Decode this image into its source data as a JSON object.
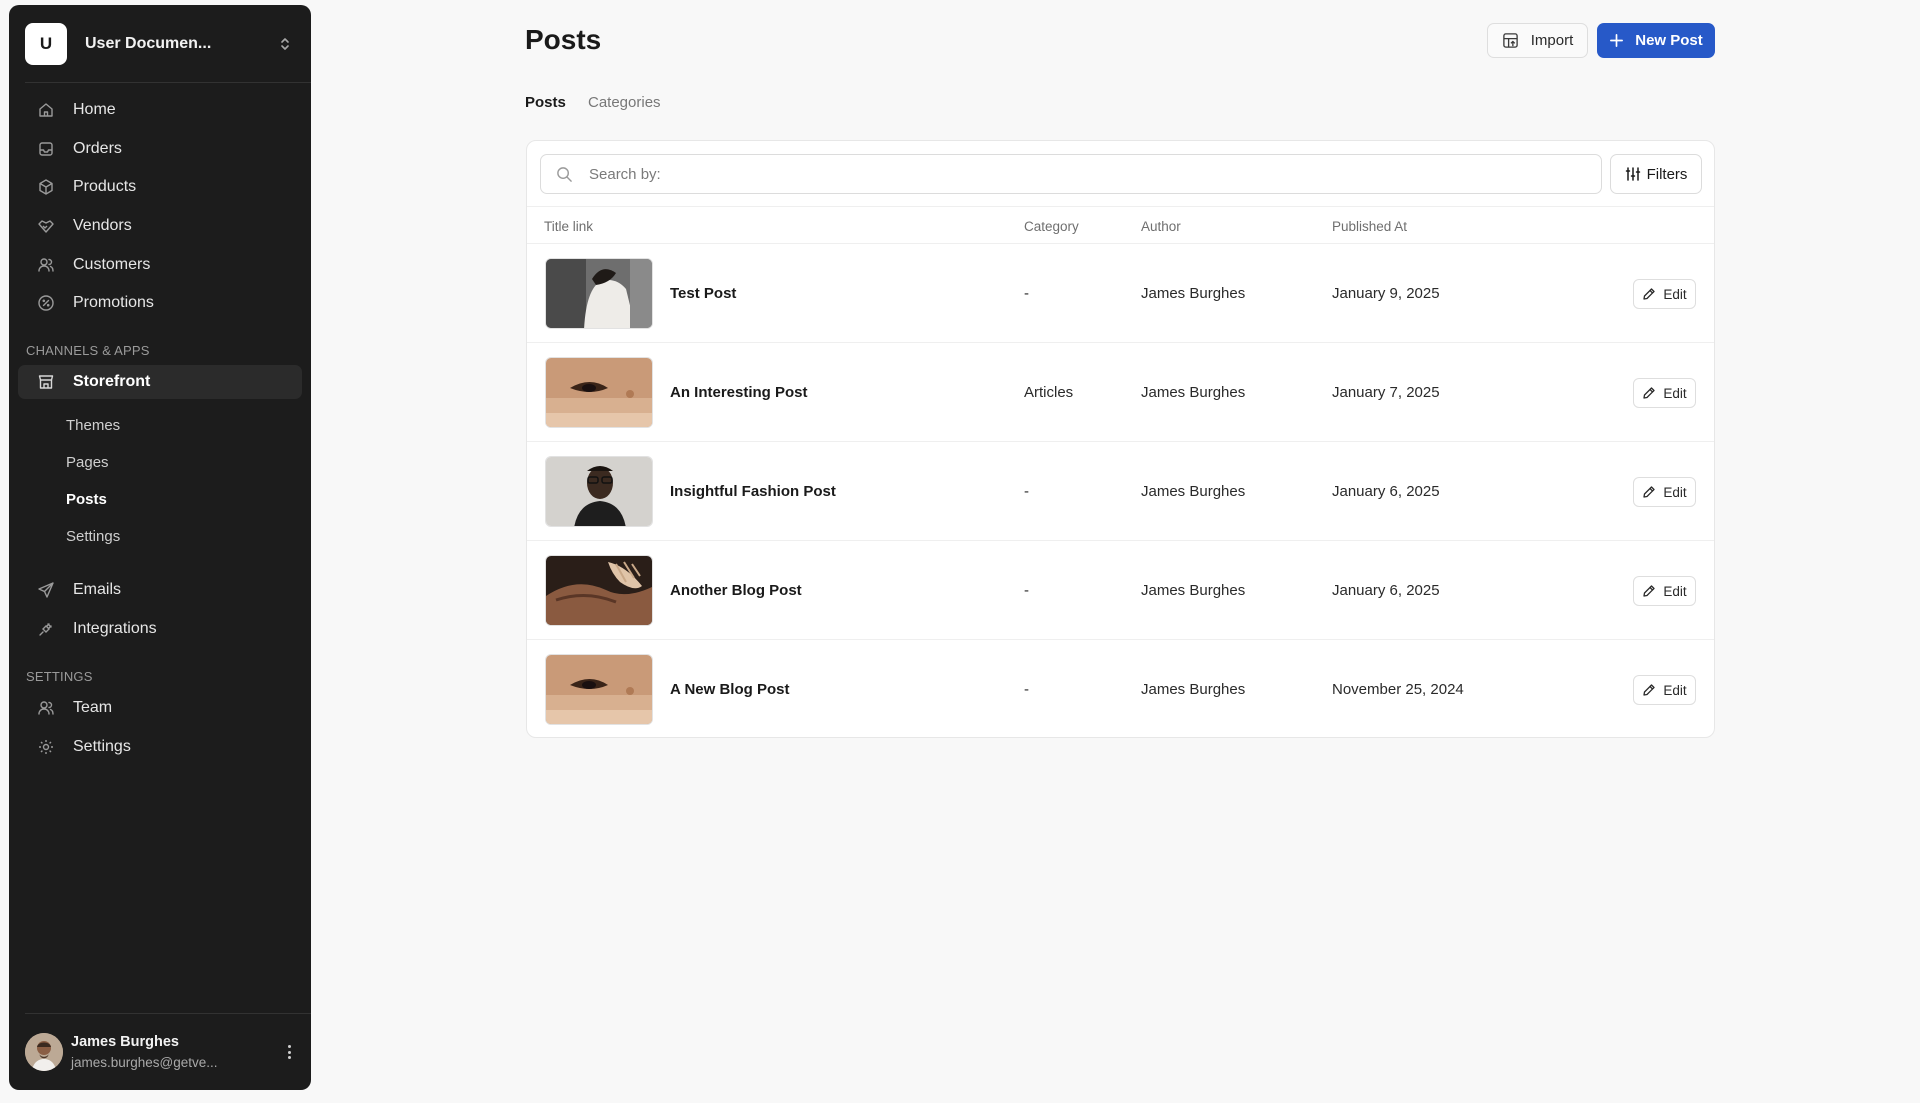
{
  "workspace": {
    "initial": "U",
    "name": "User Documen..."
  },
  "sidebar": {
    "main_items": [
      {
        "label": "Home",
        "icon": "home-icon"
      },
      {
        "label": "Orders",
        "icon": "inbox-icon"
      },
      {
        "label": "Products",
        "icon": "box-icon"
      },
      {
        "label": "Vendors",
        "icon": "handshake-icon"
      },
      {
        "label": "Customers",
        "icon": "users-icon"
      },
      {
        "label": "Promotions",
        "icon": "percent-icon"
      }
    ],
    "channels_label": "CHANNELS & APPS",
    "storefront": {
      "label": "Storefront",
      "icon": "store-icon"
    },
    "storefront_sub": [
      "Themes",
      "Pages",
      "Posts",
      "Settings"
    ],
    "extra_items": [
      {
        "label": "Emails",
        "icon": "send-icon"
      },
      {
        "label": "Integrations",
        "icon": "plug-icon"
      }
    ],
    "settings_label": "SETTINGS",
    "settings_items": [
      {
        "label": "Team",
        "icon": "users-icon"
      },
      {
        "label": "Settings",
        "icon": "gear-icon"
      }
    ]
  },
  "user": {
    "name": "James Burghes",
    "email": "james.burghes@getve..."
  },
  "header": {
    "title": "Posts",
    "import_label": "Import",
    "new_label": "New Post"
  },
  "tabs": [
    "Posts",
    "Categories"
  ],
  "search": {
    "placeholder": "Search by:",
    "filters_label": "Filters"
  },
  "table": {
    "columns": [
      "Title link",
      "Category",
      "Author",
      "Published At"
    ],
    "edit_label": "Edit",
    "rows": [
      {
        "title": "Test Post",
        "category": "-",
        "author": "James Burghes",
        "published": "January 9, 2025",
        "thumb": "white-coat"
      },
      {
        "title": "An Interesting Post",
        "category": "Articles",
        "author": "James Burghes",
        "published": "January 7, 2025",
        "thumb": "eye-closeup"
      },
      {
        "title": "Insightful Fashion Post",
        "category": "-",
        "author": "James Burghes",
        "published": "January 6, 2025",
        "thumb": "man-glasses"
      },
      {
        "title": "Another Blog Post",
        "category": "-",
        "author": "James Burghes",
        "published": "January 6, 2025",
        "thumb": "hand-face"
      },
      {
        "title": "A New Blog Post",
        "category": "-",
        "author": "James Burghes",
        "published": "November 25, 2024",
        "thumb": "eye-closeup"
      }
    ]
  },
  "colors": {
    "sidebar_bg": "#1c1c1c",
    "primary": "#2759c8",
    "page_bg": "#f8f8f8"
  }
}
